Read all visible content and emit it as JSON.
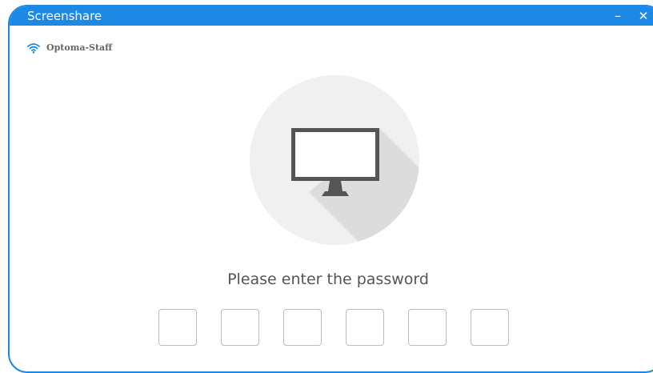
{
  "window": {
    "title": "Screenshare",
    "minimize_label": "–",
    "close_label": "✕"
  },
  "network": {
    "icon": "wifi-icon",
    "name": "Optoma-Staff"
  },
  "illustration": {
    "icon": "monitor-icon"
  },
  "prompt": {
    "text": "Please enter the password"
  },
  "password": {
    "digits": [
      "",
      "",
      "",
      "",
      "",
      ""
    ]
  },
  "colors": {
    "accent": "#1e88e5",
    "circle": "#f0f0f0",
    "monitor": "#555555",
    "text": "#555555"
  }
}
